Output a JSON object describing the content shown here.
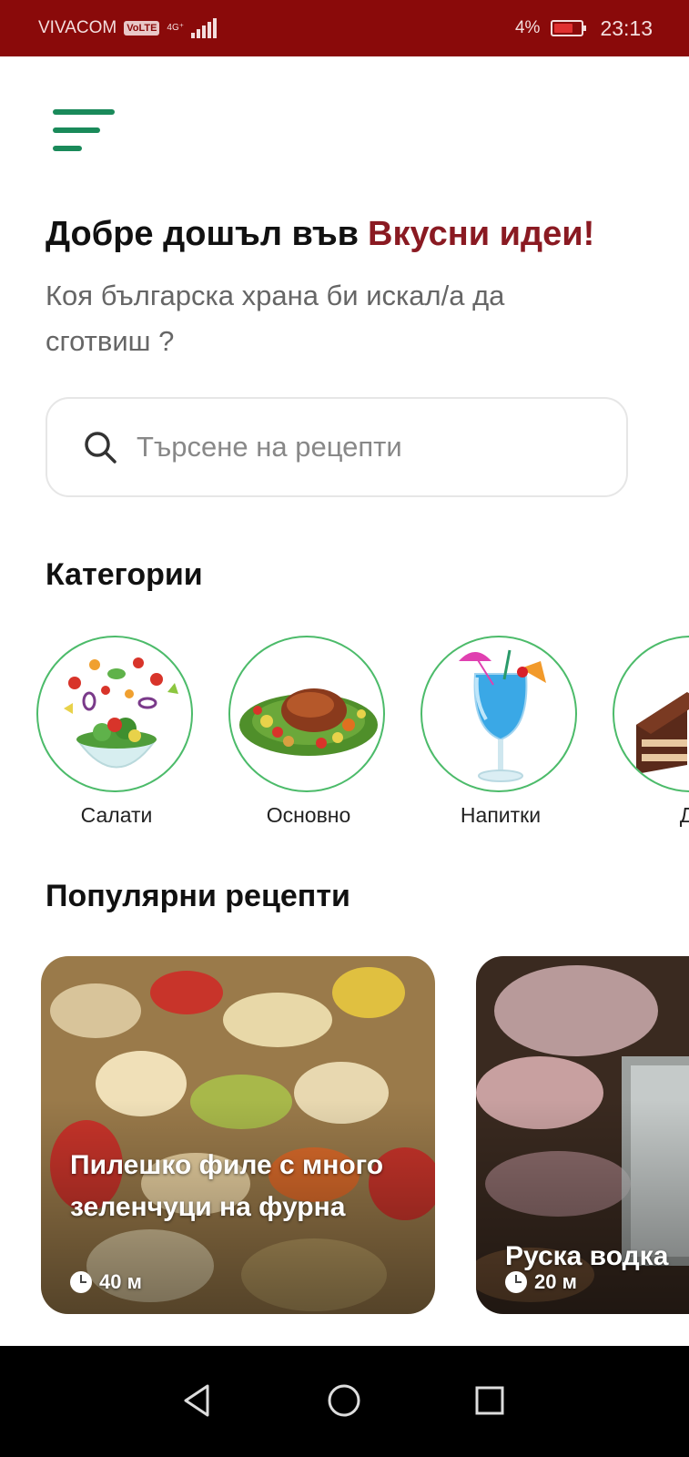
{
  "status_bar": {
    "carrier": "VIVACOM",
    "volte": "VoLTE",
    "network": "4G⁺",
    "battery_percent": "4%",
    "battery_level": 0.04,
    "time": "23:13",
    "background_color": "#8a0a0a"
  },
  "header": {
    "menu_icon": "hamburger-menu-icon",
    "welcome_text": "Добре дошъл във",
    "brand_name": "Вкусни идеи!",
    "subtitle": "Коя българска храна би искал/а да сготвиш ?"
  },
  "search": {
    "placeholder": "Търсене на рецепти",
    "value": "",
    "icon": "search-icon"
  },
  "categories": {
    "title": "Категории",
    "items": [
      {
        "label": "Салати",
        "icon": "salad-bowl-image"
      },
      {
        "label": "Основно",
        "icon": "roast-chicken-image"
      },
      {
        "label": "Напитки",
        "icon": "blue-cocktail-image"
      },
      {
        "label": "Де",
        "icon": "cake-slice-image"
      }
    ]
  },
  "popular": {
    "title": "Популярни рецепти",
    "recipes": [
      {
        "title": "Пилешко филе с много зеленчуци на фурна",
        "time": "40 м"
      },
      {
        "title": "Руска водка",
        "time": "20 м"
      }
    ]
  },
  "colors": {
    "accent_green": "#1a8a5a",
    "brand_red": "#8a1a22",
    "category_ring": "#4cbb6a"
  },
  "nav": {
    "back_icon": "back-triangle-icon",
    "home_icon": "home-circle-icon",
    "recents_icon": "recents-square-icon"
  }
}
